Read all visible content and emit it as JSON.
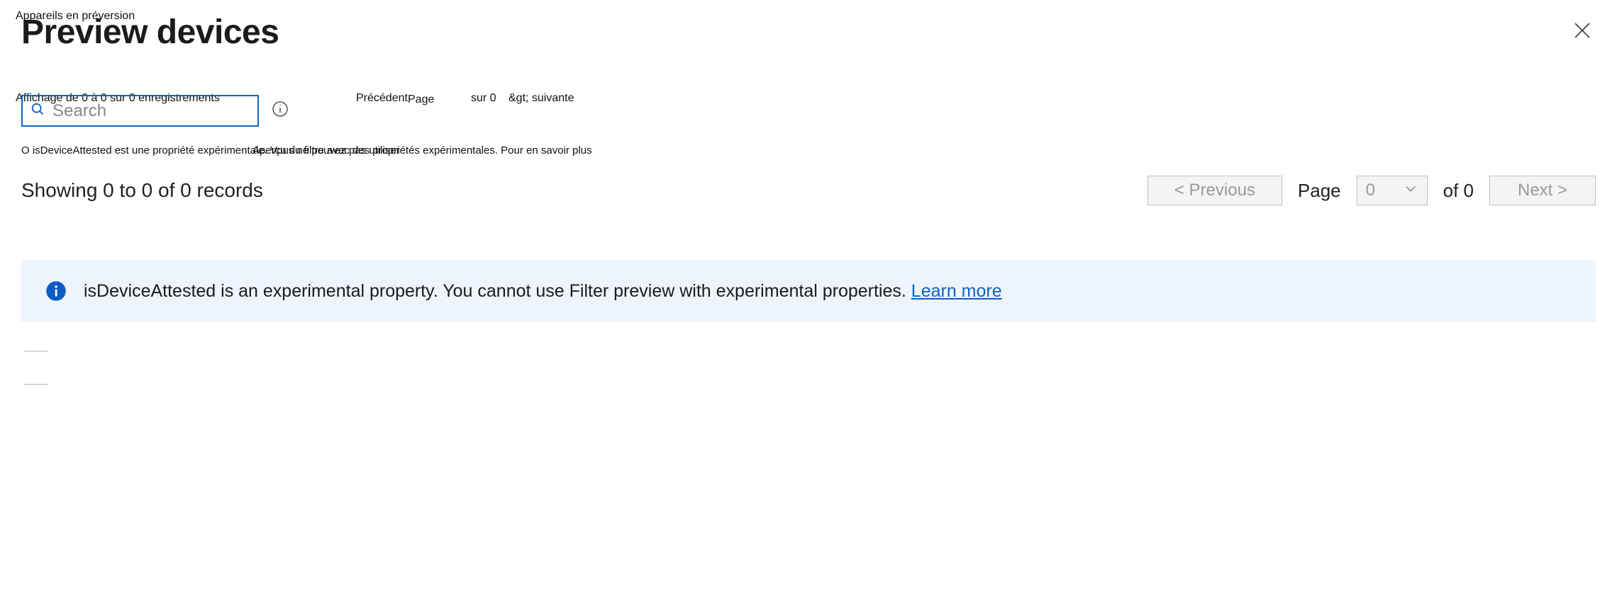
{
  "fr": {
    "title": "Appareils en préversion",
    "records": "Affichage de 0 à 0 sur 0 enregistrements",
    "prev": "Précédent",
    "page": "Page",
    "of": "sur 0",
    "next": "&gt; suivante",
    "warn1": "O isDeviceAttested est une propriété expérimentale. Vous ne pouvez pas utiliser",
    "warn2": "Aperçu du filtre avec des propriétés expérimentales. Pour en savoir plus"
  },
  "title": "Preview devices",
  "search": {
    "placeholder": "Search"
  },
  "records_text": "Showing 0 to 0 of 0 records",
  "pager": {
    "prev": "<  Previous",
    "page_label": "Page",
    "page_value": "0",
    "of_label": "of 0",
    "next": "Next  >"
  },
  "banner": {
    "text": "isDeviceAttested is an experimental property. You cannot use Filter preview with experimental properties. ",
    "link": "Learn more"
  }
}
